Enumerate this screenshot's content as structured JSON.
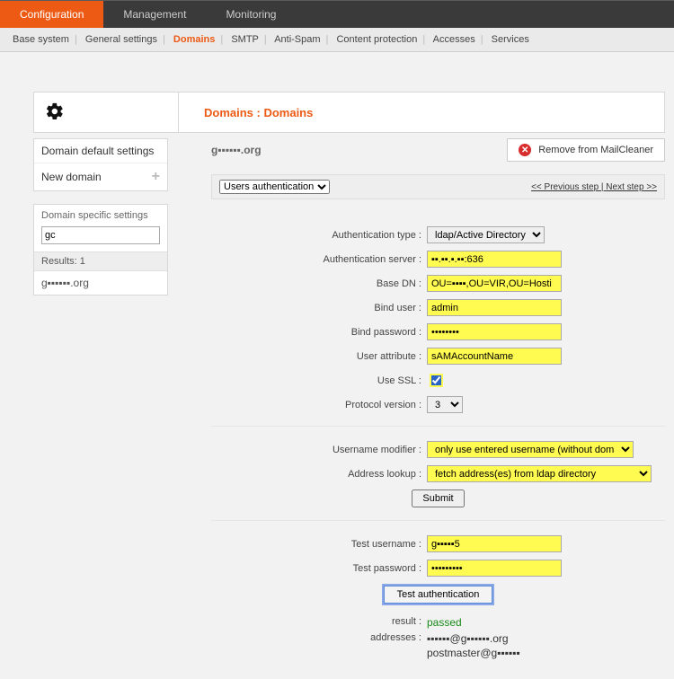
{
  "topnav": {
    "configuration": "Configuration",
    "management": "Management",
    "monitoring": "Monitoring"
  },
  "subnav": {
    "base_system": "Base system",
    "general_settings": "General settings",
    "domains": "Domains",
    "smtp": "SMTP",
    "anti_spam": "Anti-Spam",
    "content_protection": "Content protection",
    "accesses": "Accesses",
    "services": "Services"
  },
  "page_title": "Domains : Domains",
  "sidebar": {
    "default_settings": "Domain default settings",
    "new_domain": "New domain",
    "specific_settings": "Domain specific settings",
    "search_value": "gc",
    "results_label": "Results: 1",
    "domain_item": "g▪▪▪▪▪▪.org"
  },
  "detail": {
    "domain_name": "g▪▪▪▪▪▪.org",
    "remove_label": "Remove from MailCleaner",
    "step_select": "Users authentication",
    "prev_step": "<< Previous step",
    "next_step": "Next step >>"
  },
  "form": {
    "auth_type_label": "Authentication type :",
    "auth_type_value": "ldap/Active Directory",
    "auth_server_label": "Authentication server :",
    "auth_server_value": "▪▪.▪▪.▪.▪▪:636",
    "base_dn_label": "Base DN :",
    "base_dn_value": "OU=▪▪▪▪,OU=VIR,OU=Hosti",
    "bind_user_label": "Bind user :",
    "bind_user_value": "admin",
    "bind_password_label": "Bind password :",
    "bind_password_value": "••••••••",
    "user_attr_label": "User attribute :",
    "user_attr_value": "sAMAccountName",
    "use_ssl_label": "Use SSL :",
    "proto_label": "Protocol version :",
    "proto_value": "3",
    "user_mod_label": "Username modifier :",
    "user_mod_value": "only use entered username (without domain)",
    "addr_lookup_label": "Address lookup :",
    "addr_lookup_value": "fetch address(es) from ldap directory",
    "submit_label": "Submit",
    "test_user_label": "Test username :",
    "test_user_value": "g▪▪▪▪▪5",
    "test_pass_label": "Test password :",
    "test_pass_value": "•••••••••",
    "test_btn": "Test authentication",
    "result_label": "result :",
    "result_value": "passed",
    "addresses_label": "addresses :",
    "address1": "▪▪▪▪▪▪@g▪▪▪▪▪▪.org",
    "address2": "postmaster@g▪▪▪▪▪▪"
  }
}
